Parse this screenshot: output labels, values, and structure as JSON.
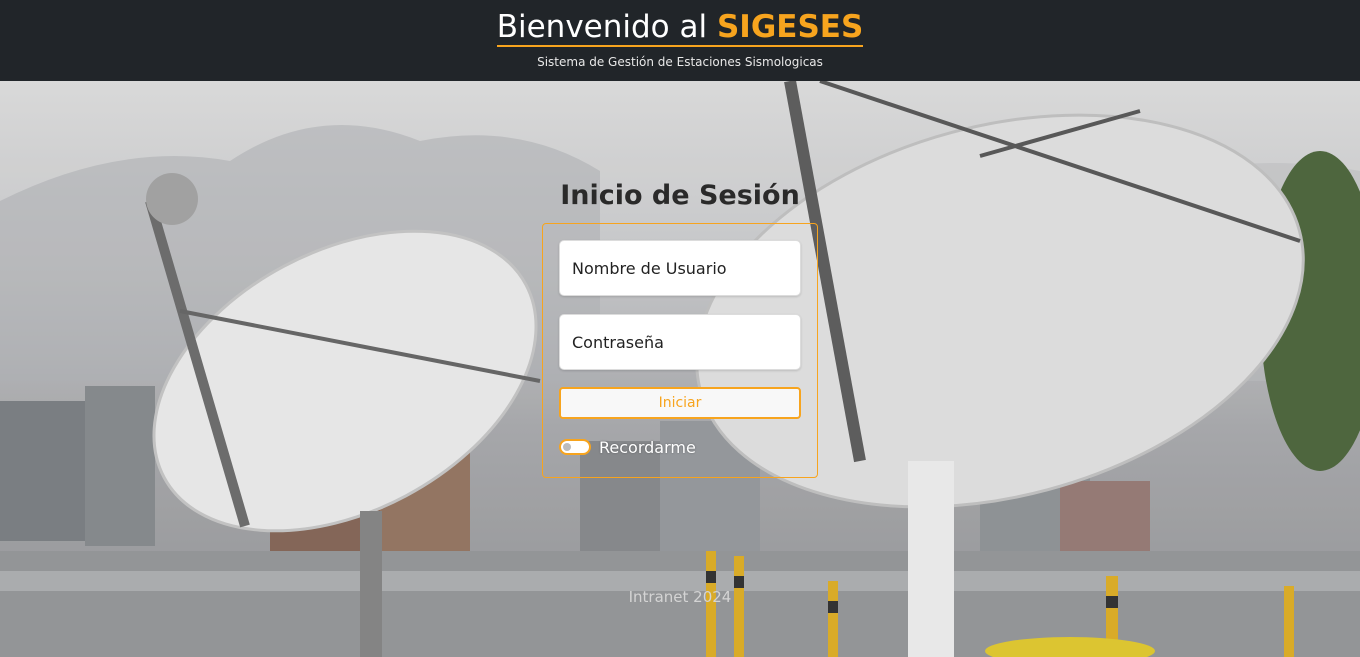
{
  "header": {
    "title_prefix": "Bienvenido al",
    "brand": "SIGESES",
    "subtitle": "Sistema de Gestión de Estaciones Sismologicas"
  },
  "login": {
    "title": "Inicio de Sesión",
    "username_placeholder": "Nombre de Usuario",
    "password_placeholder": "Contraseña",
    "submit_label": "Iniciar",
    "remember_label": "Recordarme",
    "remember_checked": false
  },
  "footer": {
    "text": "Intranet 2024"
  },
  "colors": {
    "header_bg": "#212529",
    "accent": "#f7a41e"
  },
  "background": {
    "icon": "satellite-dishes-photo"
  }
}
